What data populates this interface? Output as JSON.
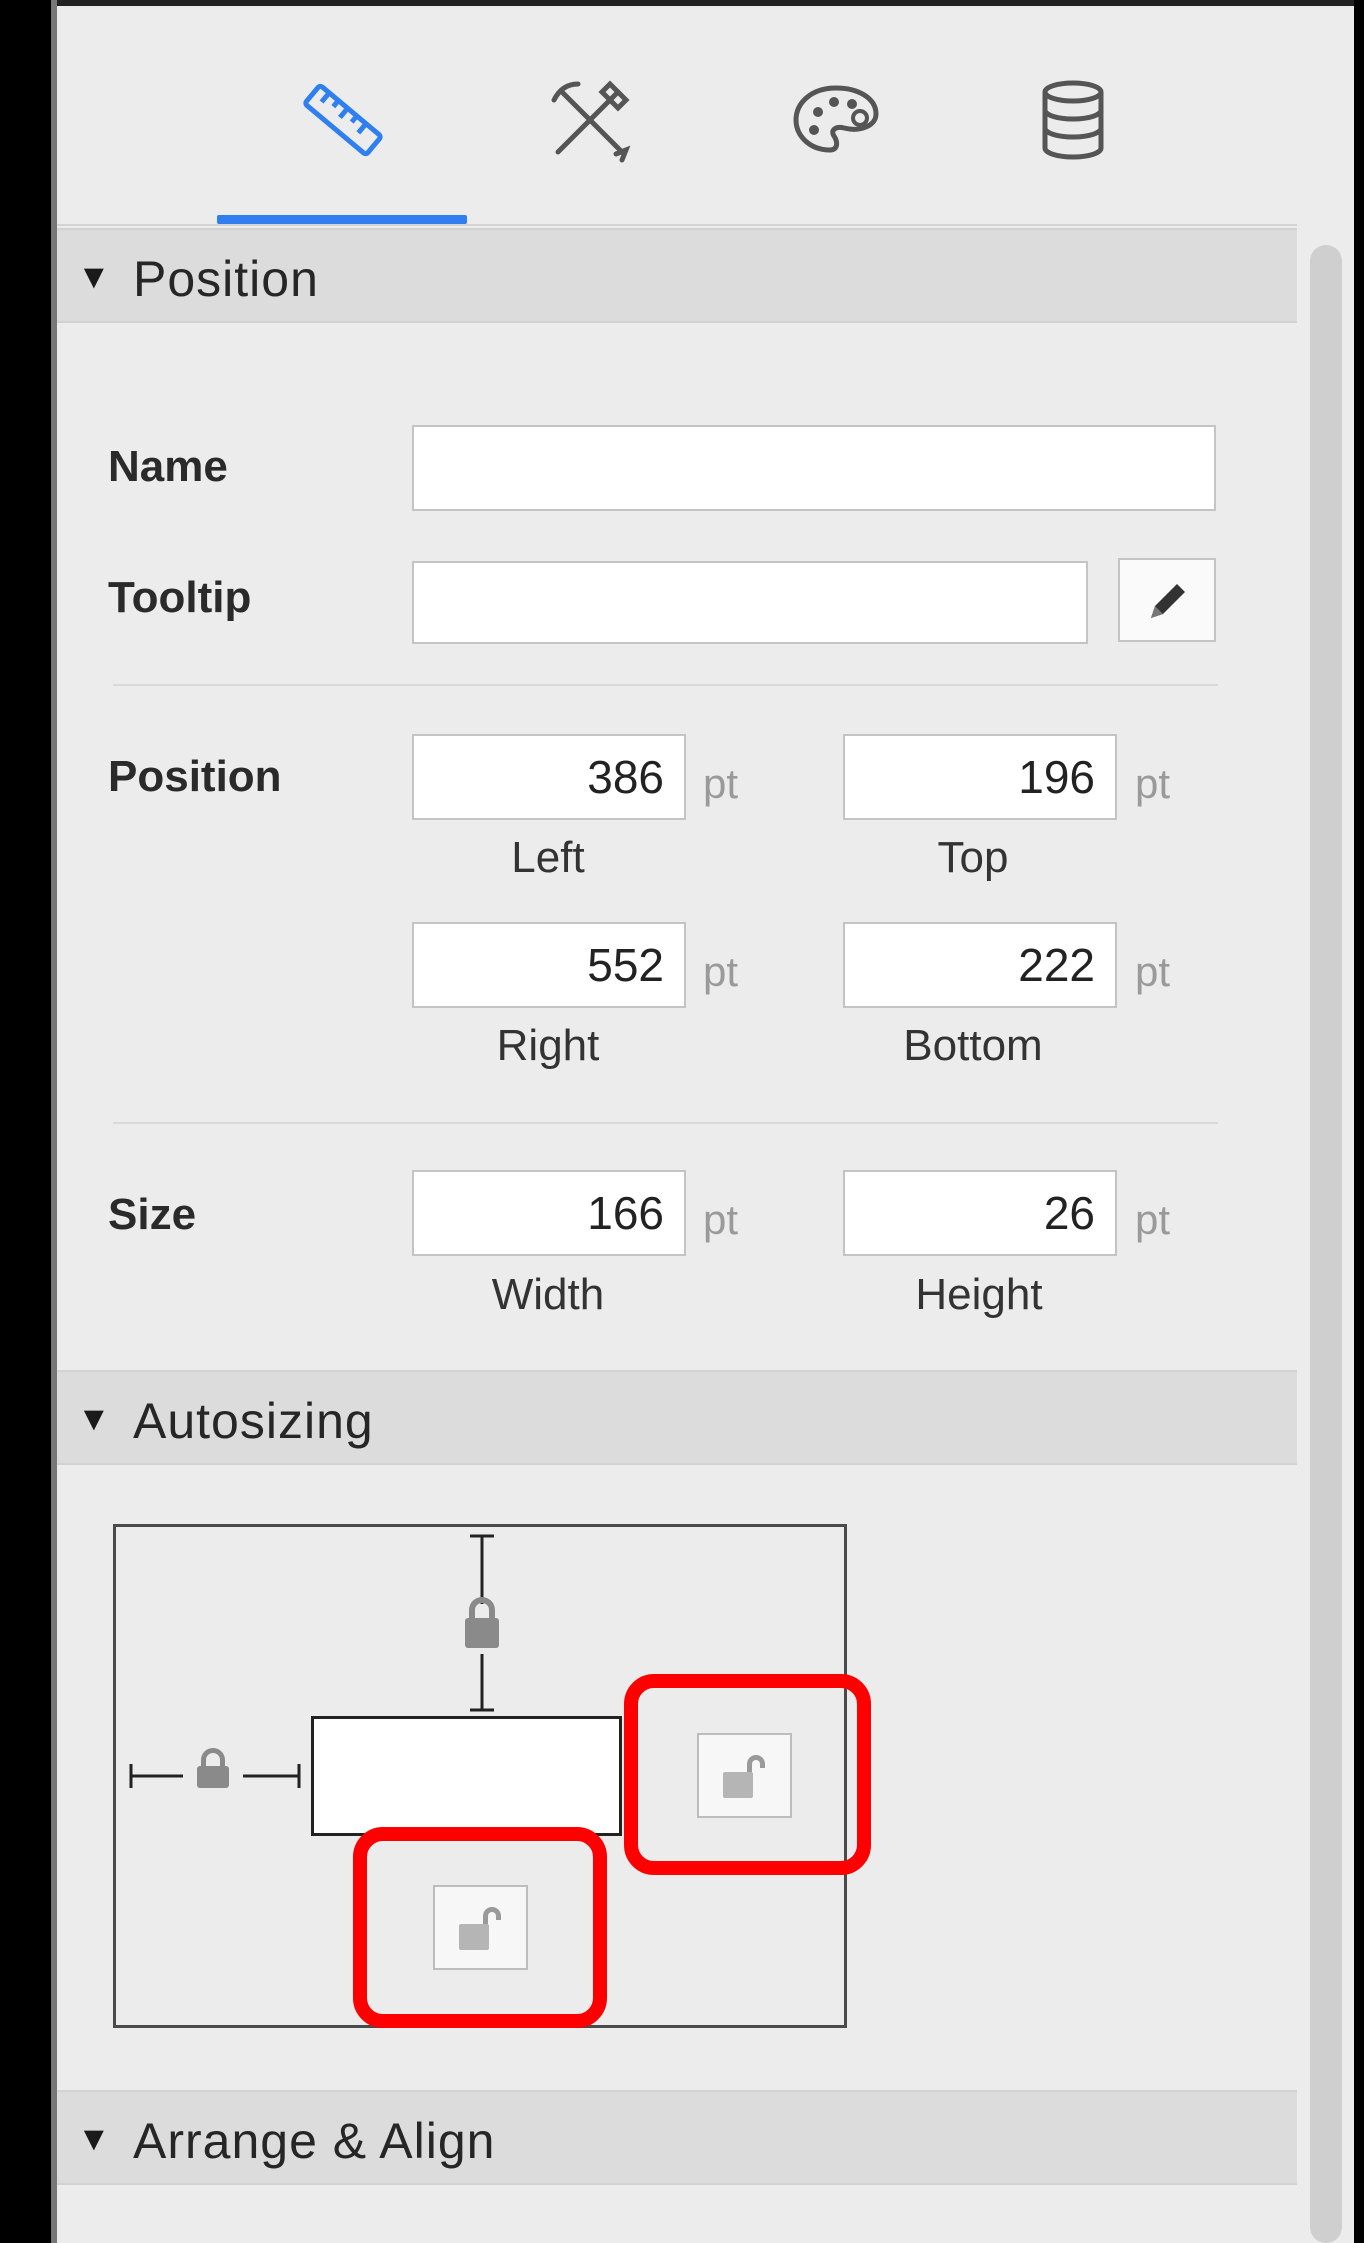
{
  "tabs": [
    {
      "name": "ruler-icon",
      "active": true
    },
    {
      "name": "tools-icon",
      "active": false
    },
    {
      "name": "palette-icon",
      "active": false
    },
    {
      "name": "database-icon",
      "active": false
    }
  ],
  "sections": {
    "position": {
      "title": "Position"
    },
    "autosizing": {
      "title": "Autosizing"
    },
    "arrange": {
      "title": "Arrange & Align"
    }
  },
  "fields": {
    "name": {
      "label": "Name",
      "value": ""
    },
    "tooltip": {
      "label": "Tooltip",
      "value": ""
    }
  },
  "position": {
    "label": "Position",
    "left": {
      "value": "386",
      "unit": "pt",
      "label": "Left"
    },
    "top": {
      "value": "196",
      "unit": "pt",
      "label": "Top"
    },
    "right": {
      "value": "552",
      "unit": "pt",
      "label": "Right"
    },
    "bottom": {
      "value": "222",
      "unit": "pt",
      "label": "Bottom"
    }
  },
  "size": {
    "label": "Size",
    "width": {
      "value": "166",
      "unit": "pt",
      "label": "Width"
    },
    "height": {
      "value": "26",
      "unit": "pt",
      "label": "Height"
    }
  },
  "colors": {
    "accent": "#2f7ff0",
    "highlight": "#ff0000"
  }
}
